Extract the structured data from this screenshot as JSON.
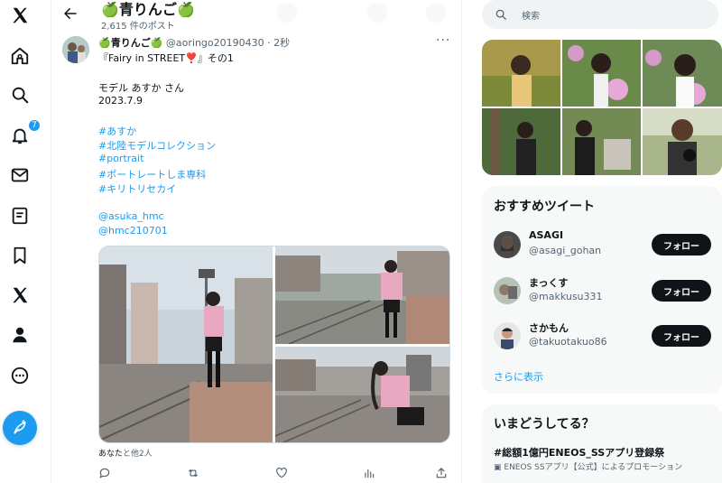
{
  "nav": {
    "notif_badge": "7"
  },
  "header": {
    "apple_left": "🍏",
    "name": "青りんご",
    "apple_right": "🍏",
    "post_count": "2,615 件のポスト"
  },
  "tweet": {
    "display_apple_left": "🍏",
    "display_name": "青りんご",
    "display_apple_right": "🍏",
    "handle_time": "@aoringo20190430 · 2秒",
    "more": "···",
    "title": "『Fairy in STREET❣️』その1",
    "lines": [
      "モデル あすか さん",
      "2023.7.9"
    ],
    "hashtags": [
      "#あすか",
      "#北陸モデルコレクション",
      "#portrait",
      "#ポートレートしま専科",
      "#キリトリセカイ"
    ],
    "mentions": [
      "@asuka_hmc",
      "@hmc210701"
    ],
    "likers_you": "あなた",
    "likers_rest": "と他2人"
  },
  "search": {
    "placeholder": "検索"
  },
  "recommended": {
    "title": "おすすめツイート",
    "users": [
      {
        "name": "ASAGI",
        "handle": "@asagi_gohan",
        "button": "フォロー"
      },
      {
        "name": "まっくす",
        "handle": "@makkusu331",
        "button": "フォロー"
      },
      {
        "name": "さかもん",
        "handle": "@takuotakuo86",
        "button": "フォロー"
      }
    ],
    "show_more": "さらに表示"
  },
  "trends": {
    "title": "いまどうしてる？",
    "tag": "#総額1億円ENEOS_SSアプリ登録祭",
    "promo": "ENEOS SSアプリ【公式】によるプロモーション"
  },
  "colors": {
    "accent": "#1d9bf0",
    "text": "#0f1419",
    "muted": "#536471"
  }
}
